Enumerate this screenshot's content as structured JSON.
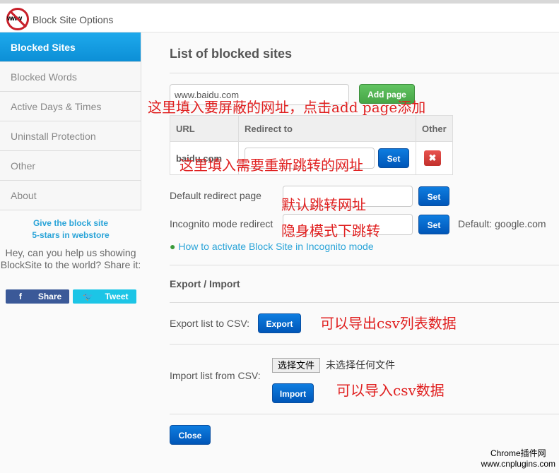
{
  "header": {
    "title": "Block Site Options",
    "logo_text": "www"
  },
  "sidebar": {
    "items": [
      {
        "label": "Blocked Sites",
        "active": true
      },
      {
        "label": "Blocked Words"
      },
      {
        "label": "Active Days & Times"
      },
      {
        "label": "Uninstall Protection"
      },
      {
        "label": "Other"
      },
      {
        "label": "About"
      }
    ]
  },
  "promo": {
    "give_line1": "Give the block site",
    "give_line2": "5-stars in webstore",
    "help": "Hey, can you help us showing BlockSite to the world? Share it:",
    "share": "Share",
    "tweet": "Tweet",
    "share_icon": "f"
  },
  "main": {
    "title": "List of blocked sites",
    "url_input_value": "www.baidu.com",
    "add_page": "Add page",
    "table": {
      "headers": [
        "URL",
        "Redirect to",
        "Other"
      ],
      "rows": [
        {
          "url": "baidu.com",
          "redirect": "",
          "set": "Set"
        }
      ]
    },
    "default_redirect_label": "Default redirect page",
    "incognito_label": "Incognito mode redirect",
    "set": "Set",
    "incognito_default": "Default: google.com",
    "incognito_help": "How to activate Block Site in Incognito mode",
    "export_import_title": "Export / Import",
    "export_label": "Export list to CSV:",
    "export": "Export",
    "import_label": "Import list from CSV:",
    "choose_file": "选择文件",
    "no_file": "未选择任何文件",
    "import": "Import",
    "close": "Close"
  },
  "annotations": [
    "这里填入要屏蔽的网址，点击add page添加",
    "这里填入需要重新跳转的网址",
    "默认跳转网址",
    "隐身模式下跳转",
    "可以导出csv列表数据",
    "可以导入csv数据"
  ],
  "watermark": {
    "line1": "Chrome插件网",
    "line2": "www.cnplugins.com"
  },
  "colors": {
    "accent": "#1ea9ec",
    "primary_button": "#0e6fd0",
    "add_button": "#5bb75b",
    "delete_button": "#d9413c"
  }
}
